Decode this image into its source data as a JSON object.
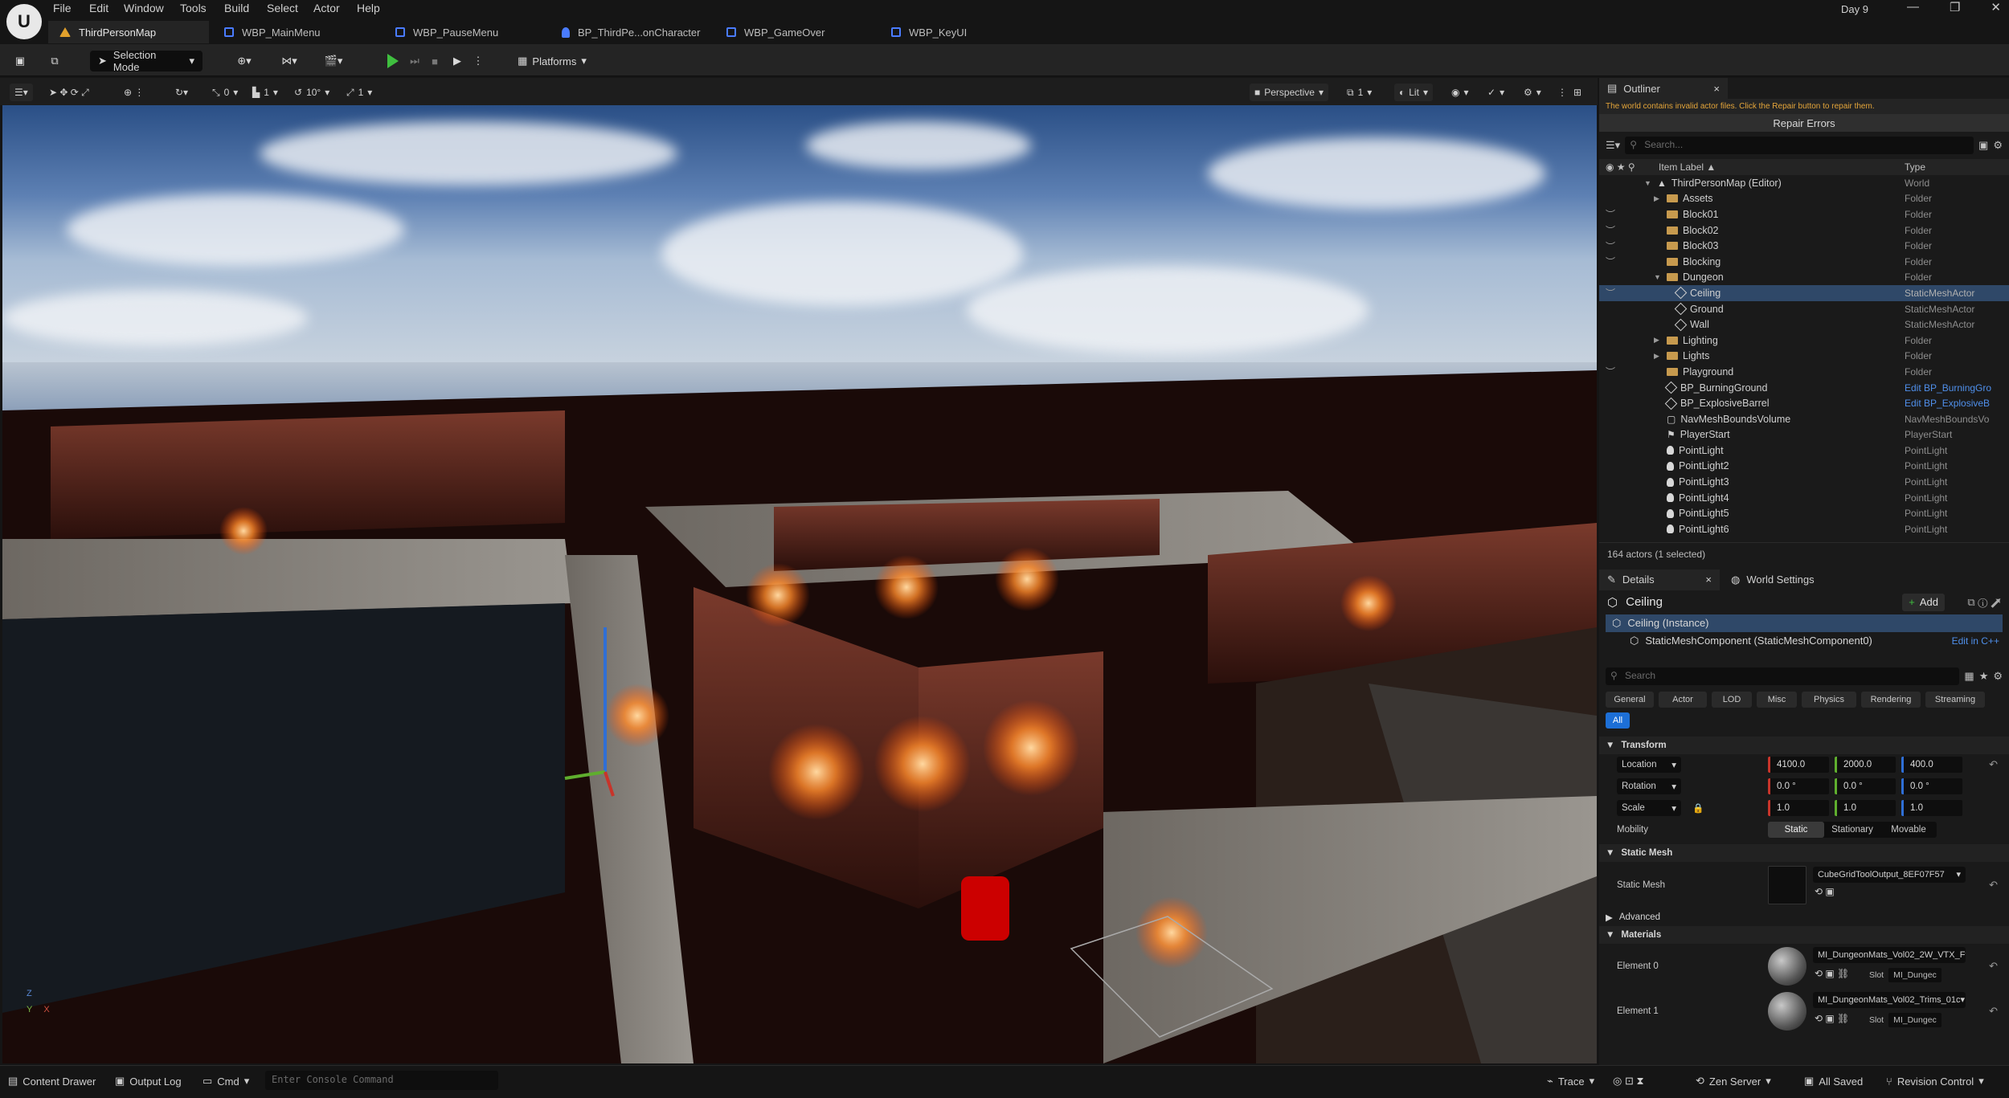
{
  "window": {
    "project": "Day 9",
    "controls": [
      "—",
      "❐",
      "✕"
    ]
  },
  "menu": [
    "File",
    "Edit",
    "Window",
    "Tools",
    "Build",
    "Select",
    "Actor",
    "Help"
  ],
  "tabs": [
    {
      "label": "ThirdPersonMap",
      "icon": "level-icon",
      "active": true
    },
    {
      "label": "WBP_MainMenu",
      "icon": "widget-blueprint-icon"
    },
    {
      "label": "WBP_PauseMenu",
      "icon": "widget-blueprint-icon"
    },
    {
      "label": "BP_ThirdPe...onCharacter",
      "icon": "character-blueprint-icon"
    },
    {
      "label": "WBP_GameOver",
      "icon": "widget-blueprint-icon"
    },
    {
      "label": "WBP_KeyUI",
      "icon": "widget-blueprint-icon"
    }
  ],
  "toolbar": {
    "selection_mode": "Selection Mode",
    "platforms": "Platforms"
  },
  "viewport_bar": {
    "snap_angle": "0",
    "grid_size": "1",
    "rotation_snap": "10°",
    "scale_snap": "1",
    "view_mode": "Perspective",
    "camera_speed": "1",
    "lighting": "Lit"
  },
  "status": {
    "content_drawer": "Content Drawer",
    "output_log": "Output Log",
    "cmd": "Cmd",
    "console_placeholder": "Enter Console Command",
    "trace": "Trace",
    "zen": "Zen Server",
    "saved": "All Saved",
    "revision": "Revision Control"
  },
  "outliner": {
    "tab": "Outliner",
    "warning": "The world contains invalid actor files. Click the Repair button to repair them.",
    "repair": "Repair Errors",
    "search_placeholder": "Search...",
    "col_label": "Item Label ▲",
    "col_type": "Type",
    "rows": [
      {
        "label": "ThirdPersonMap (Editor)",
        "type": "World",
        "indent": 0,
        "icon": "world",
        "arrow": "▼"
      },
      {
        "label": "Assets",
        "type": "Folder",
        "indent": 1,
        "icon": "folder",
        "arrow": "▶"
      },
      {
        "label": "Block01",
        "type": "Folder",
        "indent": 1,
        "icon": "folder",
        "eye": true
      },
      {
        "label": "Block02",
        "type": "Folder",
        "indent": 1,
        "icon": "folder",
        "eye": true
      },
      {
        "label": "Block03",
        "type": "Folder",
        "indent": 1,
        "icon": "folder",
        "eye": true
      },
      {
        "label": "Blocking",
        "type": "Folder",
        "indent": 1,
        "icon": "folder",
        "eye": true
      },
      {
        "label": "Dungeon",
        "type": "Folder",
        "indent": 1,
        "icon": "folder",
        "arrow": "▼"
      },
      {
        "label": "Ceiling",
        "type": "StaticMeshActor",
        "indent": 2,
        "icon": "mesh",
        "selected": true,
        "eye": true
      },
      {
        "label": "Ground",
        "type": "StaticMeshActor",
        "indent": 2,
        "icon": "mesh"
      },
      {
        "label": "Wall",
        "type": "StaticMeshActor",
        "indent": 2,
        "icon": "mesh"
      },
      {
        "label": "Lighting",
        "type": "Folder",
        "indent": 1,
        "icon": "folder",
        "arrow": "▶"
      },
      {
        "label": "Lights",
        "type": "Folder",
        "indent": 1,
        "icon": "folder",
        "arrow": "▶"
      },
      {
        "label": "Playground",
        "type": "Folder",
        "indent": 1,
        "icon": "folder",
        "eye": true
      },
      {
        "label": "BP_BurningGround",
        "type": "Edit BP_BurningGro",
        "indent": 1,
        "icon": "mesh",
        "link": true
      },
      {
        "label": "BP_ExplosiveBarrel",
        "type": "Edit BP_ExplosiveB",
        "indent": 1,
        "icon": "mesh",
        "link": true
      },
      {
        "label": "NavMeshBoundsVolume",
        "type": "NavMeshBoundsVo",
        "indent": 1,
        "icon": "volume"
      },
      {
        "label": "PlayerStart",
        "type": "PlayerStart",
        "indent": 1,
        "icon": "flag"
      },
      {
        "label": "PointLight",
        "type": "PointLight",
        "indent": 1,
        "icon": "bulb"
      },
      {
        "label": "PointLight2",
        "type": "PointLight",
        "indent": 1,
        "icon": "bulb"
      },
      {
        "label": "PointLight3",
        "type": "PointLight",
        "indent": 1,
        "icon": "bulb"
      },
      {
        "label": "PointLight4",
        "type": "PointLight",
        "indent": 1,
        "icon": "bulb"
      },
      {
        "label": "PointLight5",
        "type": "PointLight",
        "indent": 1,
        "icon": "bulb"
      },
      {
        "label": "PointLight6",
        "type": "PointLight",
        "indent": 1,
        "icon": "bulb"
      }
    ],
    "count": "164 actors (1 selected)"
  },
  "details": {
    "tab": "Details",
    "world_tab": "World Settings",
    "actor": "Ceiling",
    "add": "Add",
    "instance": "Ceiling (Instance)",
    "component": "StaticMeshComponent (StaticMeshComponent0)",
    "edit_cpp": "Edit in C++",
    "search_placeholder": "Search",
    "filters": [
      "General",
      "Actor",
      "LOD",
      "Misc",
      "Physics",
      "Rendering",
      "Streaming"
    ],
    "all": "All",
    "transform": "Transform",
    "location": {
      "label": "Location",
      "x": "4100.0",
      "y": "2000.0",
      "z": "400.0"
    },
    "rotation": {
      "label": "Rotation",
      "x": "0.0 °",
      "y": "0.0 °",
      "z": "0.0 °"
    },
    "scale": {
      "label": "Scale",
      "x": "1.0",
      "y": "1.0",
      "z": "1.0"
    },
    "mobility": {
      "label": "Mobility",
      "options": [
        "Static",
        "Stationary",
        "Movable"
      ],
      "selected": "Static"
    },
    "static_mesh_section": "Static Mesh",
    "static_mesh_label": "Static Mesh",
    "static_mesh_value": "CubeGridToolOutput_8EF07F57",
    "advanced": "Advanced",
    "materials_section": "Materials",
    "materials": [
      {
        "label": "Element 0",
        "value": "MI_DungeonMats_Vol02_2W_VTX_F",
        "slot_label": "Slot",
        "slot": "MI_Dungec"
      },
      {
        "label": "Element 1",
        "value": "MI_DungeonMats_Vol02_Trims_01c",
        "slot_label": "Slot",
        "slot": "MI_Dungec"
      }
    ]
  },
  "gizmo": {
    "z": "Z",
    "y": "Y",
    "x": "X"
  }
}
